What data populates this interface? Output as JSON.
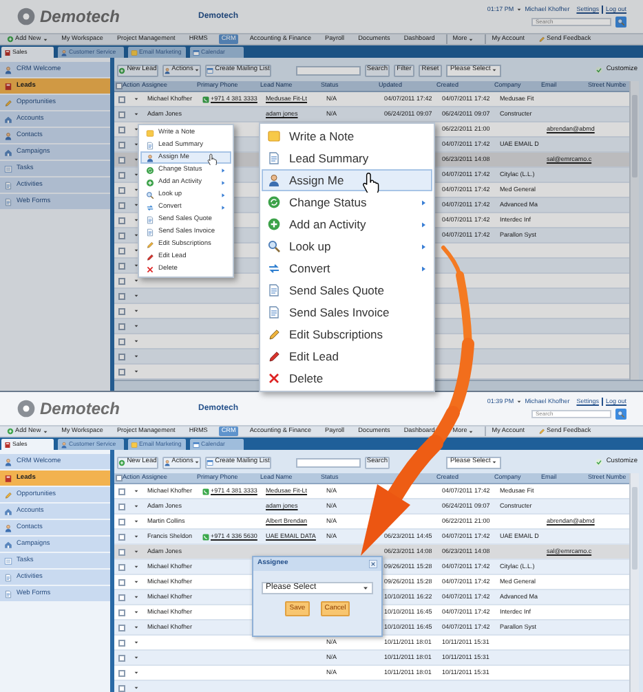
{
  "panels": [
    {
      "dimmed": true,
      "select_all_checked": false,
      "header": {
        "logo": "Demotech",
        "title": "Demotech",
        "time": "01:17 PM",
        "user": "Michael Khofher",
        "settings": "Settings",
        "logout": "Log out",
        "search_placeholder": "Search"
      },
      "nav": [
        {
          "label": "Add New",
          "selected": false,
          "dropdown": true
        },
        {
          "label": "My Workspace",
          "selected": false,
          "dropdown": false
        },
        {
          "label": "Project Management",
          "selected": false,
          "dropdown": false
        },
        {
          "label": "HRMS",
          "selected": false,
          "dropdown": false
        },
        {
          "label": "CRM",
          "selected": true,
          "dropdown": false
        },
        {
          "label": "Accounting & Finance",
          "selected": false,
          "dropdown": false
        },
        {
          "label": "Payroll",
          "selected": false,
          "dropdown": false
        },
        {
          "label": "Documents",
          "selected": false,
          "dropdown": false
        },
        {
          "label": "Dashboard",
          "selected": false,
          "dropdown": false
        },
        {
          "label": "More",
          "selected": false,
          "dropdown": true
        },
        {
          "label": "My Account",
          "selected": false,
          "dropdown": false
        },
        {
          "label": "Send Feedback",
          "selected": false,
          "dropdown": false
        }
      ],
      "subtabs": [
        {
          "label": "Sales",
          "selected": true
        },
        {
          "label": "Customer Service",
          "selected": false
        },
        {
          "label": "Email Marketing",
          "selected": false
        },
        {
          "label": "Calendar",
          "selected": false
        }
      ],
      "sidebar": [
        {
          "label": "CRM Welcome",
          "selected": false
        },
        {
          "label": "Leads",
          "selected": true
        },
        {
          "label": "Opportunities",
          "selected": false
        },
        {
          "label": "Accounts",
          "selected": false
        },
        {
          "label": "Contacts",
          "selected": false
        },
        {
          "label": "Campaigns",
          "selected": false
        },
        {
          "label": "Tasks",
          "selected": false
        },
        {
          "label": "Activities",
          "selected": false
        },
        {
          "label": "Web Forms",
          "selected": false
        }
      ],
      "toolbar": {
        "new_lead": "New Lead",
        "actions": "Actions",
        "mailing_list": "Create Mailing List",
        "search": "Search",
        "filter": "Filter",
        "reset": "Reset",
        "select": "Please Select",
        "customize": "Customize"
      },
      "columns": {
        "action": "Action",
        "assignee": "Assignee",
        "phone": "Primary Phone",
        "lead_name": "Lead Name",
        "status": "Status",
        "updated": "Updated",
        "created": "Created",
        "company": "Company",
        "email": "Email",
        "street": "Street Numbe"
      },
      "rows": [
        {
          "checked": false,
          "selected": false,
          "assignee": "Michael Khofher",
          "phone": "+971 4 381 3333",
          "lead_name": "Medusae Fit-Lt",
          "status": "N/A",
          "updated": "04/07/2011 17:42",
          "created": "04/07/2011 17:42",
          "company": "Medusae Fit"
        },
        {
          "checked": false,
          "selected": false,
          "assignee": "Adam Jones",
          "lead_name": "adam jones",
          "status": "N/A",
          "updated": "06/24/2011 09:07",
          "created": "06/24/2011 09:07",
          "company": "Constructer"
        },
        {
          "checked": false,
          "selected": false,
          "created": "06/22/2011 21:00",
          "email": "abrendan@abmd"
        },
        {
          "checked": false,
          "selected": false,
          "created": "04/07/2011 17:42",
          "company": "UAE EMAIL D"
        },
        {
          "checked": false,
          "selected": true,
          "created": "06/23/2011 14:08",
          "email": "sal@emrcamo.c"
        },
        {
          "checked": false,
          "selected": false,
          "created": "04/07/2011 17:42",
          "company": "Citylac (L.L.)"
        },
        {
          "checked": false,
          "selected": false,
          "created": "04/07/2011 17:42",
          "company": "Med General"
        },
        {
          "checked": false,
          "selected": false,
          "created": "04/07/2011 17:42",
          "company": "Advanced Ma"
        },
        {
          "checked": false,
          "selected": false,
          "created": "04/07/2011 17:42",
          "company": "Interdec Inf"
        },
        {
          "checked": false,
          "selected": false,
          "created": "04/07/2011 17:42",
          "company": "Parallon Syst"
        },
        {
          "checked": false,
          "selected": false
        },
        {
          "checked": false,
          "selected": false
        },
        {
          "checked": false,
          "selected": false
        },
        {
          "checked": false,
          "selected": false
        },
        {
          "checked": false,
          "selected": false
        },
        {
          "checked": false,
          "selected": false
        },
        {
          "checked": false,
          "selected": false
        },
        {
          "checked": false,
          "selected": false
        },
        {
          "checked": false,
          "selected": false
        }
      ]
    },
    {
      "dimmed": false,
      "select_all_checked": false,
      "header": {
        "logo": "Demotech",
        "title": "Demotech",
        "time": "01:39 PM",
        "user": "Michael Khofher",
        "settings": "Settings",
        "logout": "Log out",
        "search_placeholder": "Search"
      },
      "nav": [
        {
          "label": "Add New",
          "selected": false,
          "dropdown": true
        },
        {
          "label": "My Workspace",
          "selected": false,
          "dropdown": false
        },
        {
          "label": "Project Management",
          "selected": false,
          "dropdown": false
        },
        {
          "label": "HRMS",
          "selected": false,
          "dropdown": false
        },
        {
          "label": "CRM",
          "selected": true,
          "dropdown": false
        },
        {
          "label": "Accounting & Finance",
          "selected": false,
          "dropdown": false
        },
        {
          "label": "Payroll",
          "selected": false,
          "dropdown": false
        },
        {
          "label": "Documents",
          "selected": false,
          "dropdown": false
        },
        {
          "label": "Dashboard",
          "selected": false,
          "dropdown": false
        },
        {
          "label": "More",
          "selected": false,
          "dropdown": true
        },
        {
          "label": "My Account",
          "selected": false,
          "dropdown": false
        },
        {
          "label": "Send Feedback",
          "selected": false,
          "dropdown": false
        }
      ],
      "subtabs": [
        {
          "label": "Sales",
          "selected": true
        },
        {
          "label": "Customer Service",
          "selected": false
        },
        {
          "label": "Email Marketing",
          "selected": false
        },
        {
          "label": "Calendar",
          "selected": false
        }
      ],
      "sidebar": [
        {
          "label": "CRM Welcome",
          "selected": false
        },
        {
          "label": "Leads",
          "selected": true
        },
        {
          "label": "Opportunities",
          "selected": false
        },
        {
          "label": "Accounts",
          "selected": false
        },
        {
          "label": "Contacts",
          "selected": false
        },
        {
          "label": "Campaigns",
          "selected": false
        },
        {
          "label": "Tasks",
          "selected": false
        },
        {
          "label": "Activities",
          "selected": false
        },
        {
          "label": "Web Forms",
          "selected": false
        }
      ],
      "toolbar": {
        "new_lead": "New Lead",
        "actions": "Actions",
        "mailing_list": "Create Mailing List",
        "search": "Search",
        "select": "Please Select",
        "customize": "Customize"
      },
      "columns": {
        "action": "Action",
        "assignee": "Assignee",
        "phone": "Primary Phone",
        "lead_name": "Lead Name",
        "status": "Status",
        "created": "Created",
        "company": "Company",
        "email": "Email",
        "street": "Street Numbe"
      },
      "rows": [
        {
          "checked": false,
          "selected": false,
          "assignee": "Michael Khofher",
          "phone": "+971 4 381 3333",
          "lead_name": "Medusae Fit-Lt",
          "status": "N/A",
          "created": "04/07/2011 17:42",
          "company": "Medusae Fit"
        },
        {
          "checked": false,
          "selected": false,
          "assignee": "Adam Jones",
          "lead_name": "adam jones",
          "status": "N/A",
          "created": "06/24/2011 09:07",
          "company": "Constructer"
        },
        {
          "checked": false,
          "selected": false,
          "assignee": "Martin Collins",
          "lead_name": "Albert Brendan",
          "status": "N/A",
          "created": "06/22/2011 21:00",
          "email": "abrendan@abmd"
        },
        {
          "checked": false,
          "selected": false,
          "assignee": "Francis Sheldon",
          "phone": "+971 4 336 5630",
          "lead_name": "UAE EMAIL DATA",
          "status": "N/A",
          "updated": "06/23/2011 14:45",
          "created": "04/07/2011 17:42",
          "company": "UAE EMAIL D"
        },
        {
          "checked": false,
          "selected": true,
          "assignee": "Adam Jones",
          "updated": "06/23/2011 14:08",
          "created": "06/23/2011 14:08",
          "email": "sal@emrcamo.c"
        },
        {
          "checked": false,
          "selected": false,
          "assignee": "Michael Khofher",
          "updated": "09/26/2011 15:28",
          "created": "04/07/2011 17:42",
          "company": "Citylac (L.L.)"
        },
        {
          "checked": false,
          "selected": false,
          "assignee": "Michael Khofher",
          "updated": "09/26/2011 15:28",
          "created": "04/07/2011 17:42",
          "company": "Med General"
        },
        {
          "checked": false,
          "selected": false,
          "assignee": "Michael Khofher",
          "updated": "10/10/2011 16:22",
          "created": "04/07/2011 17:42",
          "company": "Advanced Ma"
        },
        {
          "checked": false,
          "selected": false,
          "assignee": "Michael Khofher",
          "updated": "10/10/2011 16:45",
          "created": "04/07/2011 17:42",
          "company": "Interdec Inf"
        },
        {
          "checked": false,
          "selected": false,
          "assignee": "Michael Khofher",
          "updated": "10/10/2011 16:45",
          "created": "04/07/2011 17:42",
          "company": "Parallon Syst"
        },
        {
          "checked": false,
          "selected": false,
          "status": "N/A",
          "updated": "10/11/2011 18:01",
          "created": "10/11/2011 15:31"
        },
        {
          "checked": false,
          "selected": false,
          "status": "N/A",
          "updated": "10/11/2011 18:01",
          "created": "10/11/2011 15:31"
        },
        {
          "checked": false,
          "selected": false,
          "status": "N/A",
          "updated": "10/11/2011 18:01",
          "created": "10/11/2011 15:31"
        },
        {
          "checked": false,
          "selected": false
        }
      ]
    }
  ],
  "context_menu": {
    "items": [
      {
        "label": "Write a Note",
        "selected": false,
        "submenu": false
      },
      {
        "label": "Lead Summary",
        "selected": false,
        "submenu": false
      },
      {
        "label": "Assign Me",
        "selected": true,
        "submenu": false
      },
      {
        "label": "Change Status",
        "selected": false,
        "submenu": true
      },
      {
        "label": "Add an Activity",
        "selected": false,
        "submenu": true
      },
      {
        "label": "Look up",
        "selected": false,
        "submenu": true
      },
      {
        "label": "Convert",
        "selected": false,
        "submenu": true
      },
      {
        "label": "Send Sales Quote",
        "selected": false,
        "submenu": false
      },
      {
        "label": "Send Sales Invoice",
        "selected": false,
        "submenu": false
      },
      {
        "label": "Edit Subscriptions",
        "selected": false,
        "submenu": false
      },
      {
        "label": "Edit Lead",
        "selected": false,
        "submenu": false
      },
      {
        "label": "Delete",
        "selected": false,
        "submenu": false
      }
    ]
  },
  "zoomed_menu": {
    "items": [
      {
        "label": "Write a Note",
        "selected": false,
        "submenu": false
      },
      {
        "label": "Lead Summary",
        "selected": false,
        "submenu": false
      },
      {
        "label": "Assign Me",
        "selected": true,
        "submenu": false
      },
      {
        "label": "Change Status",
        "selected": false,
        "submenu": true
      },
      {
        "label": "Add an Activity",
        "selected": false,
        "submenu": true
      },
      {
        "label": "Look up",
        "selected": false,
        "submenu": true
      },
      {
        "label": "Convert",
        "selected": false,
        "submenu": true
      },
      {
        "label": "Send Sales Quote",
        "selected": false,
        "submenu": false
      },
      {
        "label": "Send Sales Invoice",
        "selected": false,
        "submenu": false
      },
      {
        "label": "Edit Subscriptions",
        "selected": false,
        "submenu": false
      },
      {
        "label": "Edit Lead",
        "selected": false,
        "submenu": false
      },
      {
        "label": "Delete",
        "selected": false,
        "submenu": false
      }
    ]
  },
  "assign_dialog": {
    "title": "Assignee",
    "select": "Please Select",
    "save": "Save",
    "cancel": "Cancel"
  }
}
